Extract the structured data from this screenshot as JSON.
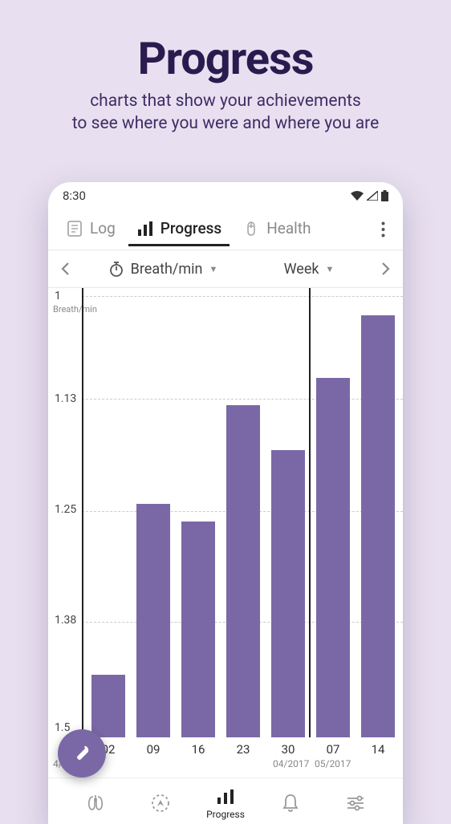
{
  "hero": {
    "title": "Progress",
    "line1": "charts that show your achievements",
    "line2": "to see where you were and where you are"
  },
  "status": {
    "time": "8:30"
  },
  "tabs": {
    "log": "Log",
    "progress": "Progress",
    "health": "Health"
  },
  "selector": {
    "metric": "Breath/min",
    "period": "Week"
  },
  "chart_data": {
    "type": "bar",
    "ylabel": "Breath/min",
    "ylim": [
      1.5,
      1.0
    ],
    "y_ticks": [
      "1",
      "1.13",
      "1.25",
      "1.38",
      "1.5"
    ],
    "categories": [
      "02",
      "09",
      "16",
      "23",
      "30",
      "07",
      "14"
    ],
    "month_groups": [
      "4/2017",
      "04/2017",
      "05/2017"
    ],
    "values": [
      1.43,
      1.24,
      1.26,
      1.13,
      1.18,
      1.1,
      1.03
    ]
  },
  "bottomNav": {
    "progress": "Progress"
  },
  "colors": {
    "accent": "#7a68a6",
    "bg": "#e8e0f0"
  }
}
